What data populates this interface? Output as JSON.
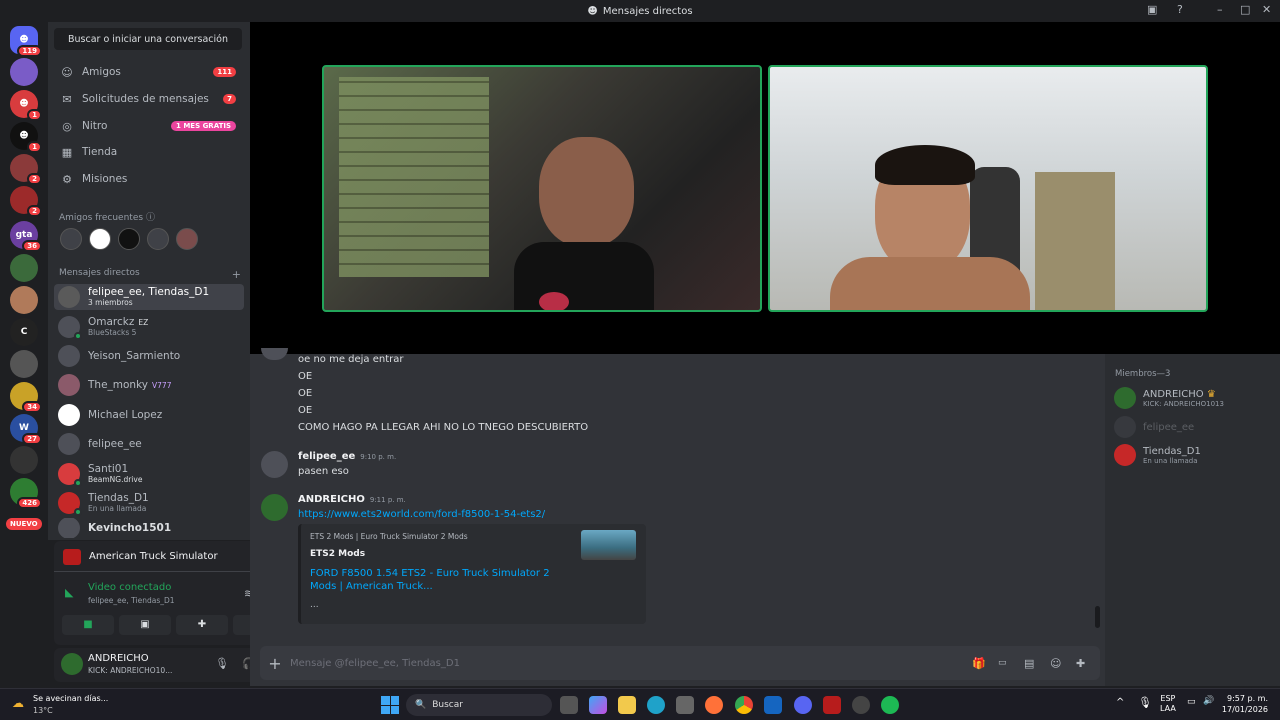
{
  "window": {
    "title": "Mensajes directos"
  },
  "guild_badges": {
    "home": "119",
    "g2": "1",
    "g3": "1",
    "g4": "2",
    "g5": "2",
    "gta": "36",
    "t1": "34",
    "t2": "27",
    "t3": "426",
    "nuevo": "NUEVO"
  },
  "sidebar": {
    "search_label": "Buscar o iniciar una conversación",
    "nav": [
      {
        "label": "Amigos",
        "badge": "111"
      },
      {
        "label": "Solicitudes de mensajes",
        "badge": "7"
      },
      {
        "label": "Nitro",
        "badge": "1 MES GRATIS"
      },
      {
        "label": "Tienda",
        "badge": ""
      },
      {
        "label": "Misiones",
        "badge": ""
      }
    ],
    "frequent_friends_header": "Amigos frecuentes",
    "dm_header": "Mensajes directos",
    "dms": [
      {
        "name": "felipee_ee, Tiendas_D1",
        "sub": "3 miembros",
        "tag": ""
      },
      {
        "name": "Omarckz",
        "sub": "BlueStacks 5",
        "tag": "EZ"
      },
      {
        "name": "Yeison_Sarmiento",
        "sub": "",
        "tag": ""
      },
      {
        "name": "The_monky",
        "sub": "",
        "tag": "V777"
      },
      {
        "name": "Michael Lopez",
        "sub": "",
        "tag": ""
      },
      {
        "name": "felipee_ee",
        "sub": "",
        "tag": ""
      },
      {
        "name": "Santi01",
        "sub": "BeamNG.drive",
        "tag": ""
      },
      {
        "name": "Tiendas_D1",
        "sub": "En una llamada",
        "tag": ""
      },
      {
        "name": "Kevincho1501",
        "sub": "",
        "tag": ""
      }
    ]
  },
  "activity": {
    "game": "American Truck Simulator",
    "voice_status": "Video conectado",
    "voice_channel": "felipee_ee, Tiendas_D1"
  },
  "user": {
    "name": "ANDREICHO",
    "status": "KICK: ANDREICHO10..."
  },
  "messages": {
    "continuation": [
      "oe no me deja entrar",
      "OE",
      "OE",
      "OE",
      "COMO HAGO PA LLEGAR AHI NO LO TNEGO DESCUBIERTO"
    ],
    "m1": {
      "author": "felipee_ee",
      "time": "9:10 p. m.",
      "text": "pasen eso"
    },
    "m2": {
      "author": "ANDREICHO",
      "time": "9:11 p. m.",
      "link": "https://www.ets2world.com/ford-f8500-1-54-ets2/"
    },
    "embed": {
      "provider": "ETS 2 Mods | Euro Truck Simulator 2 Mods",
      "site": "ETS2 Mods",
      "title": "FORD F8500 1.54 ETS2 - Euro Truck Simulator 2 Mods | American Truck...",
      "desc": "..."
    }
  },
  "composer": {
    "placeholder": "Mensaje @felipee_ee, Tiendas_D1"
  },
  "members": {
    "header": "Miembros—3",
    "list": [
      {
        "name": "ANDREICHO",
        "sub": "KICK: ANDREICHO1013"
      },
      {
        "name": "felipee_ee",
        "sub": ""
      },
      {
        "name": "Tiendas_D1",
        "sub": "En una llamada"
      }
    ]
  },
  "taskbar": {
    "weather_title": "Se avecinan días...",
    "weather_temp": "13°C",
    "search": "Buscar",
    "lang": "ESP",
    "lang2": "LAA",
    "time": "9:57 p. m.",
    "date": "17/01/2026"
  },
  "colors": {
    "accent": "#5865f2",
    "online": "#23a55a",
    "danger": "#f23f43",
    "link": "#00a8fc"
  }
}
